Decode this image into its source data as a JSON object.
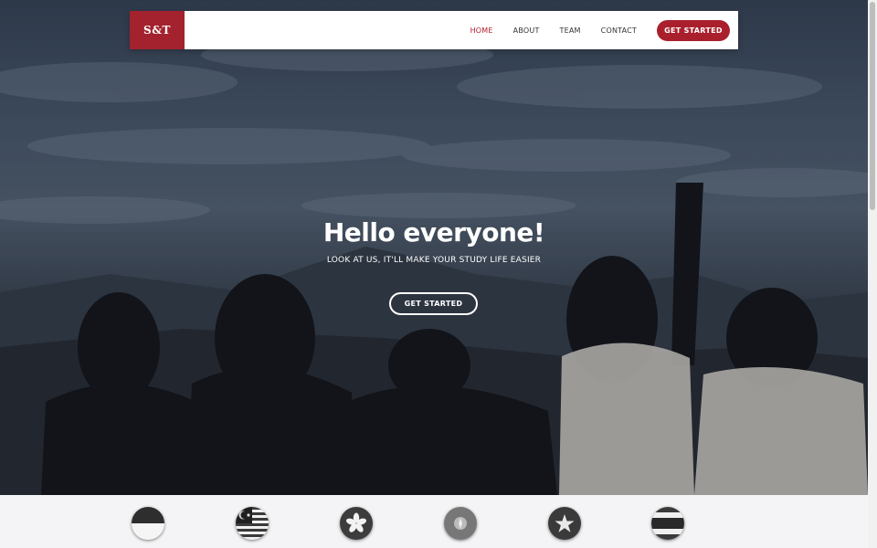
{
  "navbar": {
    "logo_text": "S&T",
    "links": [
      "HOME",
      "ABOUT",
      "TEAM",
      "CONTACT"
    ],
    "active": "HOME",
    "cta_label": "GET STARTED"
  },
  "hero": {
    "title": "Hello everyone!",
    "subtitle": "LOOK AT US, IT'LL MAKE YOUR STUDY LIFE EASIER",
    "button_label": "GET STARTED"
  },
  "flags": [
    "indonesia-flag-icon",
    "malaysia-flag-icon",
    "hong-kong-flag-icon",
    "flag-icon",
    "vietnam-flag-icon",
    "thailand-flag-icon"
  ],
  "colors": {
    "brand": "#a9202c",
    "active_link": "#b3202c"
  }
}
